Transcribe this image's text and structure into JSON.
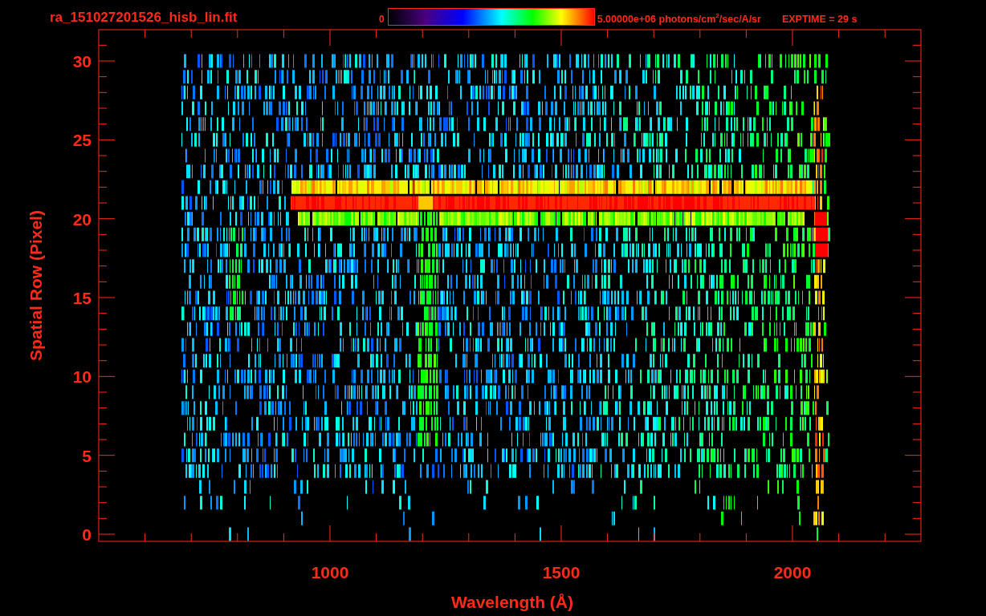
{
  "header": {
    "file_name": "ra_151027201526_hisb_lin.fit",
    "colorbar": {
      "min_label": "0",
      "max_label": "5.00000e+06 photons/cm$^{2}$/sec/A/sr"
    },
    "exposure": "EXPTIME = 29 s"
  },
  "plot": {
    "xlabel": "Wavelength (Å)",
    "ylabel": "Spatial Row (Pixel)",
    "xticks": [
      "1000",
      "1500",
      "2000"
    ],
    "yticks": [
      "30",
      "25",
      "20",
      "15",
      "10",
      "5",
      "0"
    ]
  }
}
